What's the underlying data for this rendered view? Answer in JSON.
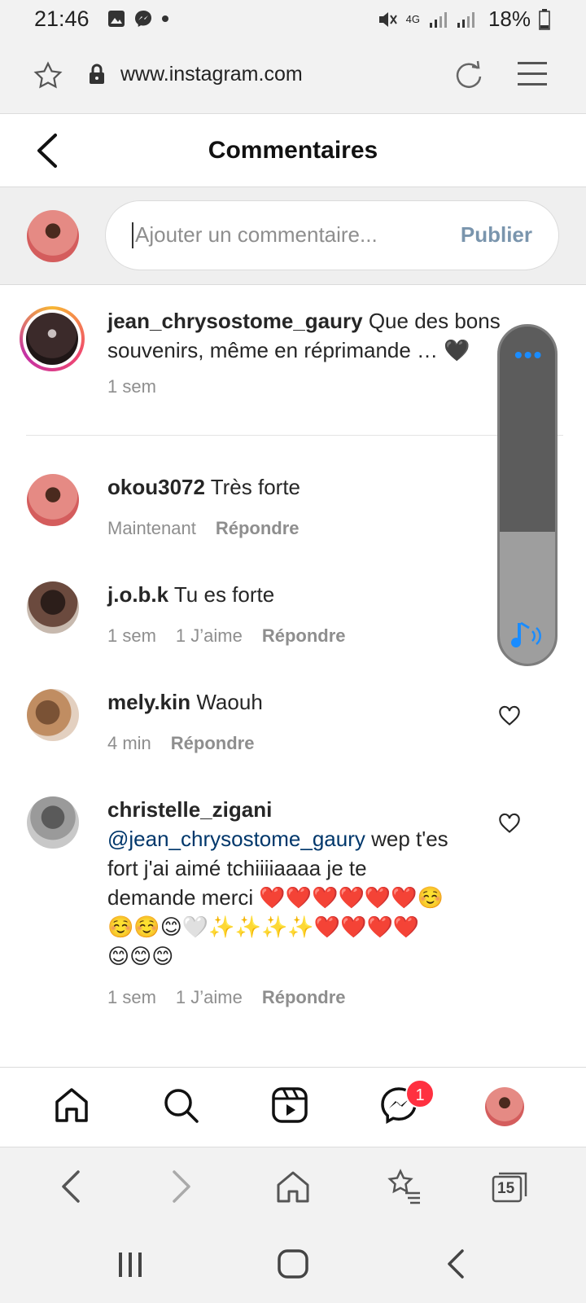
{
  "status_bar": {
    "time": "21:46",
    "network": "4G",
    "battery": "18%"
  },
  "browser": {
    "url": "www.instagram.com",
    "tab_count": "15"
  },
  "header": {
    "title": "Commentaires"
  },
  "compose": {
    "placeholder": "Ajouter un commentaire...",
    "publish_label": "Publier"
  },
  "caption": {
    "username": "jean_chrysostome_gaury",
    "text_line1": "Que des bons",
    "text_line2": "souvenirs, même en réprimande … 🖤",
    "time": "1 sem"
  },
  "comments": [
    {
      "username": "okou3072",
      "text": "Très forte",
      "time": "Maintenant",
      "likes": "",
      "reply": "Répondre"
    },
    {
      "username": "j.o.b.k",
      "text": "Tu es forte",
      "time": "1 sem",
      "likes": "1 J’aime",
      "reply": "Répondre"
    },
    {
      "username": "mely.kin",
      "text": "Waouh",
      "time": "4 min",
      "likes": "",
      "reply": "Répondre"
    },
    {
      "username": "christelle_zigani",
      "mention": "@jean_chrysostome_gaury",
      "text_after_mention": " wep t'es",
      "line3": "fort j'ai aimé tchiiiiaaaa je te",
      "line4": "demande merci ❤️❤️❤️❤️❤️❤️☺️",
      "line5": "☺️☺️😊🤍✨✨✨✨❤️❤️❤️❤️",
      "line6": "😊😊😊",
      "time": "1 sem",
      "likes": "1 J’aime",
      "reply": "Répondre"
    }
  ],
  "nav": {
    "messages_badge": "1"
  },
  "colors": {
    "accent": "#0095f6",
    "publish_disabled": "#7a95ad",
    "badge": "#ff3040",
    "mention": "#00376b"
  }
}
